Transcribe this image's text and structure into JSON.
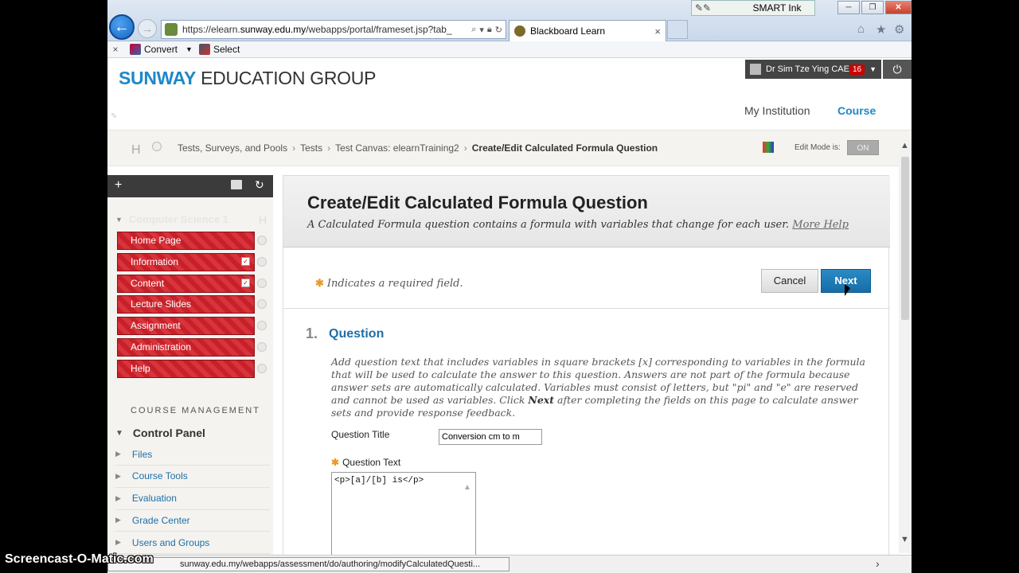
{
  "browser": {
    "url_prefix": "https://elearn.",
    "url_domain": "sunway.edu.my",
    "url_suffix": "/webapps/portal/frameset.jsp?tab_",
    "tab_title": "Blackboard Learn",
    "tab_close": "×",
    "smart_ink_label": "SMART Ink",
    "cmd_close": "×",
    "convert_label": "Convert",
    "select_label": "Select",
    "min_glyph": "─",
    "max_glyph": "❐",
    "close_glyph": "✕",
    "home_glyph": "⌂",
    "star_glyph": "★",
    "gear_glyph": "⚙",
    "status_url": "sunway.edu.my/webapps/assessment/do/authoring/modifyCalculatedQuesti..."
  },
  "header": {
    "logo_sunway": "SUNWAY",
    "logo_edu": " EDUCATION GROUP",
    "user_name": "Dr Sim Tze Ying CAE",
    "notification_count": "16",
    "tab_my_institution": "My Institution",
    "tab_course": "Course"
  },
  "breadcrumb": {
    "home_letter": "H",
    "items": [
      "Tests, Surveys, and Pools",
      "Tests",
      "Test Canvas: elearnTraining2"
    ],
    "current": "Create/Edit Calculated Formula Question",
    "edit_mode_label": "Edit Mode is:",
    "edit_mode_value": "ON"
  },
  "course_menu": {
    "course_title": "Computer Science 1",
    "course_title_letter": "H",
    "items": [
      {
        "label": "Home Page",
        "check": false
      },
      {
        "label": "Information",
        "check": true
      },
      {
        "label": "Content",
        "check": true
      },
      {
        "label": "Lecture Slides",
        "check": false
      },
      {
        "label": "Assignment",
        "check": false
      },
      {
        "label": "Administration",
        "check": false
      },
      {
        "label": "Help",
        "check": false
      }
    ],
    "management_heading": "COURSE MANAGEMENT",
    "control_panel_title": "Control Panel",
    "control_panel_items": [
      "Files",
      "Course Tools",
      "Evaluation",
      "Grade Center",
      "Users and Groups"
    ]
  },
  "page": {
    "title": "Create/Edit Calculated Formula Question",
    "description": "A Calculated Formula question contains a formula with variables that change for each user.",
    "more_help": "More Help",
    "required_note": "Indicates a required field.",
    "cancel_label": "Cancel",
    "next_label": "Next",
    "step_number": "1.",
    "step_title": "Question",
    "instructions_part1": "Add question text that includes variables in square brackets [x] corresponding to variables in the formula that will be used to calculate the answer to this question. Answers are not part of the formula because answer sets are automatically calculated. Variables must consist of letters, but \"pi\" and \"e\" are reserved and cannot be used as variables. Click ",
    "instructions_bold": "Next",
    "instructions_part2": " after completing the fields on this page to calculate answer sets and provide response feedback.",
    "question_title_label": "Question Title",
    "question_title_value": "Conversion cm to m",
    "question_text_label": "Question Text",
    "question_text_value": "<p>[a]/[b] is</p>"
  },
  "watermark": "Screencast-O-Matic.com",
  "colors": {
    "accent": "#1e88c8",
    "menu_red": "#c8202a",
    "next_blue": "#1b76b0"
  }
}
